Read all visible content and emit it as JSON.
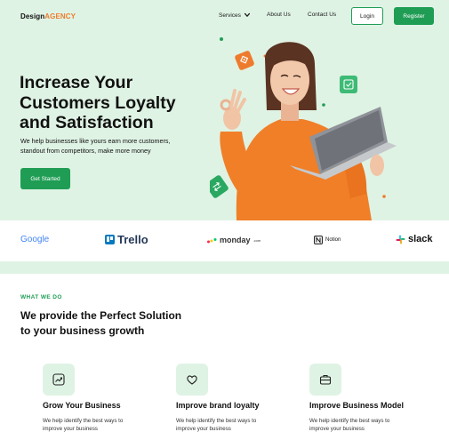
{
  "header": {
    "logo_primary": "Design",
    "logo_accent": "AGENCY",
    "nav": [
      {
        "label": "Services"
      },
      {
        "label": "About Us"
      },
      {
        "label": "Contact Us"
      }
    ],
    "login_label": "Login",
    "register_label": "Register"
  },
  "hero": {
    "headline_line1": "Increase Your",
    "headline_line2": "Customers Loyalty",
    "headline_line3": "and Satisfaction",
    "subtext_line1": "We help businesses like yours earn more customers,",
    "subtext_line2": "standout from competitors, make more money",
    "cta_label": "Get Started"
  },
  "partners": [
    {
      "name": "Google"
    },
    {
      "name": "Trello"
    },
    {
      "name": "monday",
      "suffix": ".com"
    },
    {
      "name": "Notion"
    },
    {
      "name": "slack"
    }
  ],
  "what_we_do": {
    "eyebrow": "WHAT WE DO",
    "title_line1": "We provide the Perfect Solution",
    "title_line2": "to your business growth",
    "features": [
      {
        "title": "Grow Your Business",
        "desc_line1": "We help identify the best ways to",
        "desc_line2": "improve your business"
      },
      {
        "title": "Improve brand loyalty",
        "desc_line1": "We help identify the best ways to",
        "desc_line2": "improve your business"
      },
      {
        "title": "Improve Business Model",
        "desc_line1": "We help identify the best ways to",
        "desc_line2": "improve your business"
      }
    ]
  },
  "colors": {
    "accent_green": "#1f9d55",
    "hero_bg": "#dff3e4",
    "logo_orange": "#ee7b2d"
  }
}
